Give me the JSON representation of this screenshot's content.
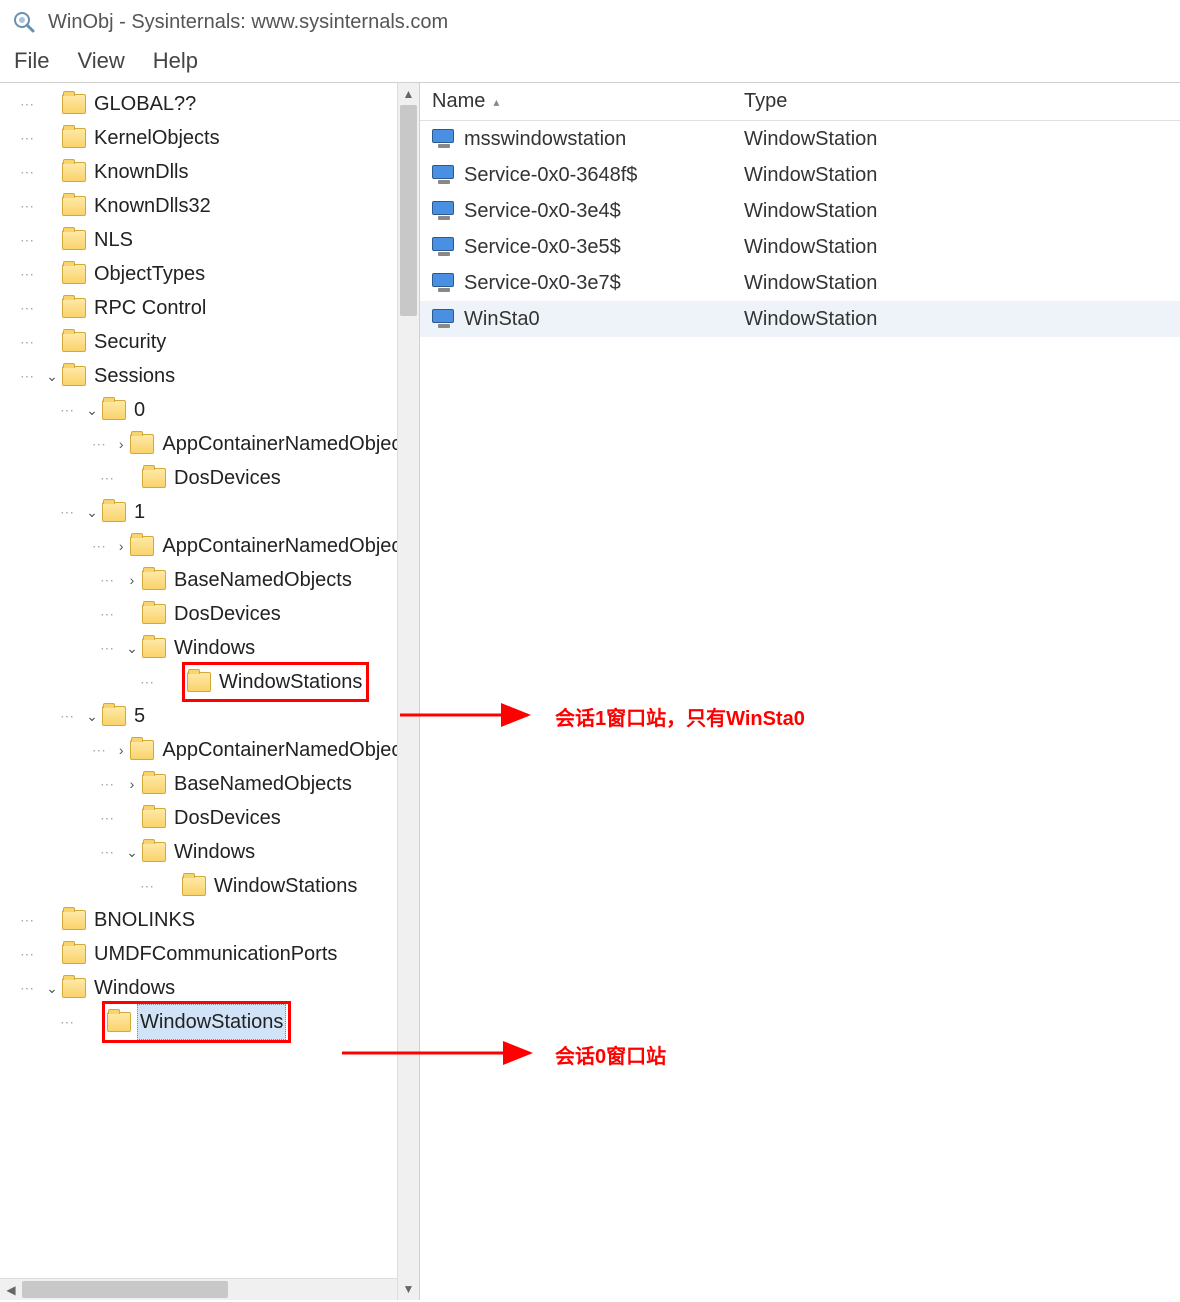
{
  "window": {
    "title": "WinObj - Sysinternals: www.sysinternals.com"
  },
  "menu": {
    "file": "File",
    "view": "View",
    "help": "Help"
  },
  "tree": {
    "nodes": [
      {
        "indent": 1,
        "expand": "",
        "label": "GLOBAL??"
      },
      {
        "indent": 1,
        "expand": "",
        "label": "KernelObjects"
      },
      {
        "indent": 1,
        "expand": "",
        "label": "KnownDlls"
      },
      {
        "indent": 1,
        "expand": "",
        "label": "KnownDlls32"
      },
      {
        "indent": 1,
        "expand": "",
        "label": "NLS"
      },
      {
        "indent": 1,
        "expand": "",
        "label": "ObjectTypes"
      },
      {
        "indent": 1,
        "expand": "",
        "label": "RPC Control"
      },
      {
        "indent": 1,
        "expand": "",
        "label": "Security"
      },
      {
        "indent": 1,
        "expand": "v",
        "label": "Sessions"
      },
      {
        "indent": 2,
        "expand": "v",
        "label": "0"
      },
      {
        "indent": 3,
        "expand": ">",
        "label": "AppContainerNamedObjects"
      },
      {
        "indent": 3,
        "expand": "",
        "label": "DosDevices"
      },
      {
        "indent": 2,
        "expand": "v",
        "label": "1"
      },
      {
        "indent": 3,
        "expand": ">",
        "label": "AppContainerNamedObjects"
      },
      {
        "indent": 3,
        "expand": ">",
        "label": "BaseNamedObjects"
      },
      {
        "indent": 3,
        "expand": "",
        "label": "DosDevices"
      },
      {
        "indent": 3,
        "expand": "v",
        "label": "Windows"
      },
      {
        "indent": 4,
        "expand": "",
        "label": "WindowStations",
        "redbox": true
      },
      {
        "indent": 2,
        "expand": "v",
        "label": "5"
      },
      {
        "indent": 3,
        "expand": ">",
        "label": "AppContainerNamedObjects"
      },
      {
        "indent": 3,
        "expand": ">",
        "label": "BaseNamedObjects"
      },
      {
        "indent": 3,
        "expand": "",
        "label": "DosDevices"
      },
      {
        "indent": 3,
        "expand": "v",
        "label": "Windows"
      },
      {
        "indent": 4,
        "expand": "",
        "label": "WindowStations"
      },
      {
        "indent": 1,
        "expand": "",
        "label": "BNOLINKS"
      },
      {
        "indent": 1,
        "expand": "",
        "label": "UMDFCommunicationPorts"
      },
      {
        "indent": 1,
        "expand": "v",
        "label": "Windows"
      },
      {
        "indent": 2,
        "expand": "",
        "label": "WindowStations",
        "redbox": true,
        "selected": true
      }
    ]
  },
  "list": {
    "columns": {
      "name": "Name",
      "type": "Type"
    },
    "rows": [
      {
        "name": "msswindowstation",
        "type": "WindowStation"
      },
      {
        "name": "Service-0x0-3648f$",
        "type": "WindowStation"
      },
      {
        "name": "Service-0x0-3e4$",
        "type": "WindowStation"
      },
      {
        "name": "Service-0x0-3e5$",
        "type": "WindowStation"
      },
      {
        "name": "Service-0x0-3e7$",
        "type": "WindowStation"
      },
      {
        "name": "WinSta0",
        "type": "WindowStation",
        "selected": true
      }
    ]
  },
  "annotations": {
    "a1": "会话1窗口站，只有WinSta0",
    "a2": "会话0窗口站"
  }
}
